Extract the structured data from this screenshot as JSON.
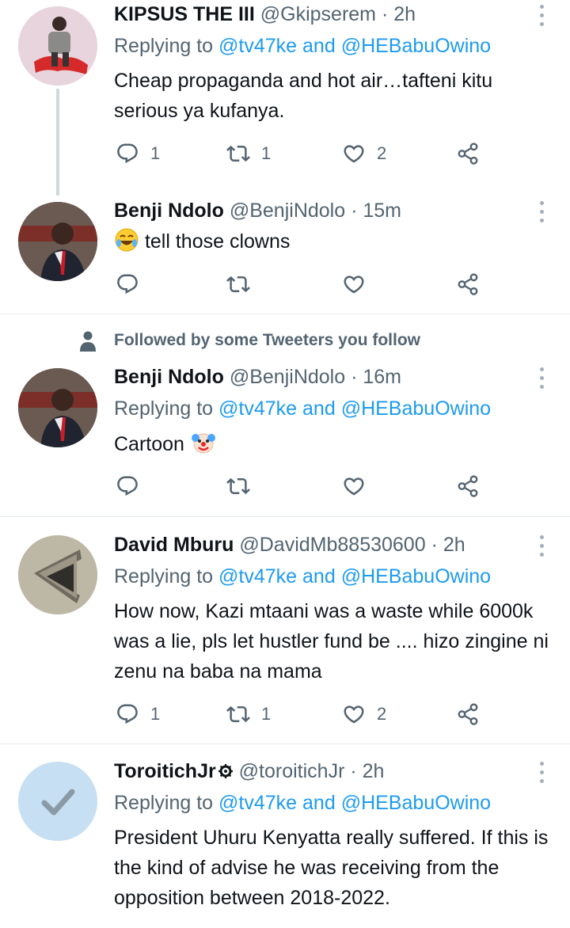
{
  "tweets": [
    {
      "name": "KIPSUS THE III",
      "handle": "@Gkipserem",
      "time": "2h",
      "replying_prefix": "Replying to",
      "mention1": "@tv47ke",
      "and": "and",
      "mention2": "@HEBabuOwino",
      "text": "Cheap propaganda and hot air…tafteni kitu serious ya kufanya.",
      "replies": "1",
      "retweets": "1",
      "likes": "2"
    },
    {
      "name": "Benji Ndolo",
      "handle": "@BenjiNdolo",
      "time": "15m",
      "text": "tell those clowns",
      "replies": "",
      "retweets": "",
      "likes": ""
    },
    {
      "social_context": "Followed by some Tweeters you follow",
      "name": "Benji Ndolo",
      "handle": "@BenjiNdolo",
      "time": "16m",
      "replying_prefix": "Replying to",
      "mention1": "@tv47ke",
      "and": "and",
      "mention2": "@HEBabuOwino",
      "text": "Cartoon",
      "replies": "",
      "retweets": "",
      "likes": ""
    },
    {
      "name": "David Mburu",
      "handle": "@DavidMb88530600",
      "time": "2h",
      "replying_prefix": "Replying to",
      "mention1": "@tv47ke",
      "and": "and",
      "mention2": "@HEBabuOwino",
      "text": "How now, Kazi mtaani was a waste while 6000k was a lie, pls let hustler fund be .... hizo zingine ni zenu na baba na mama",
      "replies": "1",
      "retweets": "1",
      "likes": "2"
    },
    {
      "name": "ToroitichJr",
      "handle": "@toroitichJr",
      "time": "2h",
      "replying_prefix": "Replying to",
      "mention1": "@tv47ke",
      "and": "and",
      "mention2": "@HEBabuOwino",
      "text": "President Uhuru Kenyatta really suffered. If this is the kind of advise he was receiving from the opposition between 2018-2022."
    }
  ],
  "sep": "·",
  "colors": {
    "link": "#1d9bf0",
    "secondary": "#536471",
    "divider": "#e6ecf0"
  },
  "icons": [
    "reply-icon",
    "retweet-icon",
    "like-icon",
    "share-icon",
    "more-icon",
    "person-icon",
    "rolling-laughing-emoji",
    "clown-emoji",
    "gear-badge-icon"
  ]
}
